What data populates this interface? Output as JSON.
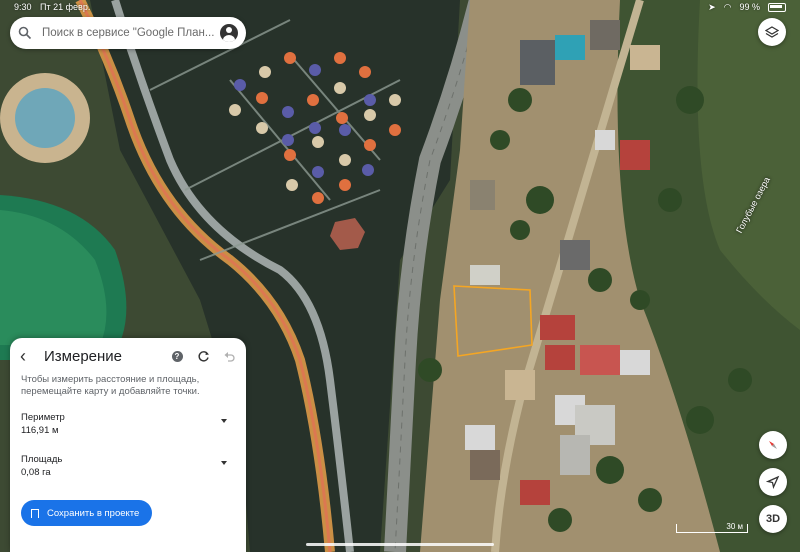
{
  "status_bar": {
    "time": "9:30",
    "date": "Пт 21 февр.",
    "battery": "99 %"
  },
  "search": {
    "placeholder": "Поиск в сервисе \"Google План..."
  },
  "map": {
    "place_label": "Голубые озера",
    "scale_label": "30 м"
  },
  "measure_panel": {
    "title": "Измерение",
    "instructions": "Чтобы измерить расстояние и площадь, перемещайте карту и добавляйте точки.",
    "perimeter_label": "Периметр",
    "perimeter_value": "116,91 м",
    "area_label": "Площадь",
    "area_value": "0,08 га",
    "save_button": "Сохранить в проекте"
  },
  "controls": {
    "threed_label": "3D"
  },
  "colors": {
    "accent": "#1a73e8",
    "measure_outline": "#f5a623"
  }
}
